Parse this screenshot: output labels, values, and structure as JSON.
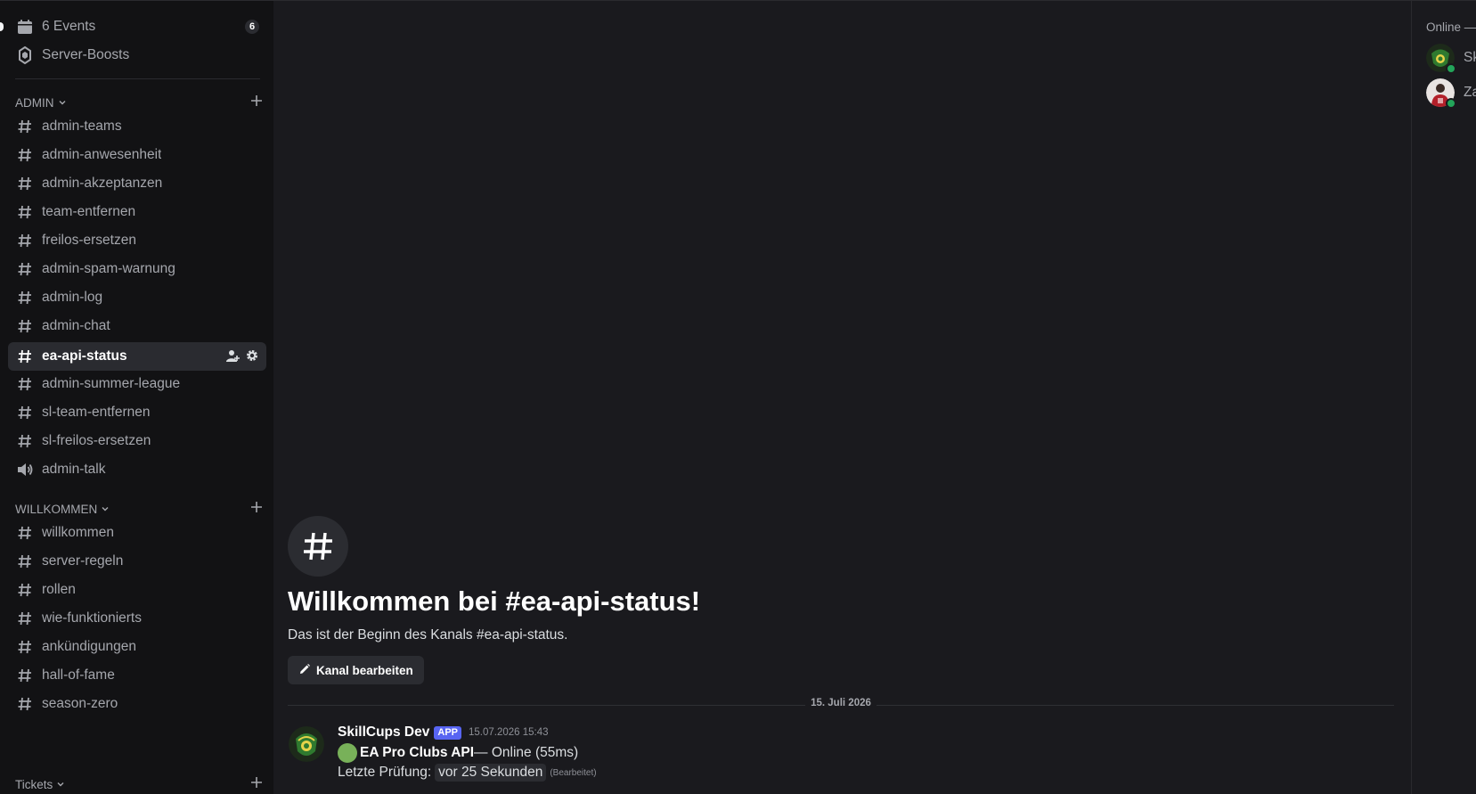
{
  "sidebar": {
    "top_items": [
      {
        "label": "6 Events",
        "icon": "calendar-icon",
        "badge": "6"
      },
      {
        "label": "Server-Boosts",
        "icon": "boost-icon"
      }
    ],
    "categories": [
      {
        "name": "ADMIN",
        "channels": [
          {
            "label": "admin-teams",
            "type": "text"
          },
          {
            "label": "admin-anwesenheit",
            "type": "text"
          },
          {
            "label": "admin-akzeptanzen",
            "type": "text"
          },
          {
            "label": "team-entfernen",
            "type": "text"
          },
          {
            "label": "freilos-ersetzen",
            "type": "text"
          },
          {
            "label": "admin-spam-warnung",
            "type": "text"
          },
          {
            "label": "admin-log",
            "type": "text"
          },
          {
            "label": "admin-chat",
            "type": "text"
          },
          {
            "label": "ea-api-status",
            "type": "text",
            "active": true
          },
          {
            "label": "admin-summer-league",
            "type": "text"
          },
          {
            "label": "sl-team-entfernen",
            "type": "text"
          },
          {
            "label": "sl-freilos-ersetzen",
            "type": "text"
          },
          {
            "label": "admin-talk",
            "type": "voice"
          }
        ]
      },
      {
        "name": "WILLKOMMEN",
        "channels": [
          {
            "label": "willkommen",
            "type": "text"
          },
          {
            "label": "server-regeln",
            "type": "text"
          },
          {
            "label": "rollen",
            "type": "text"
          },
          {
            "label": "wie-funktionierts",
            "type": "text"
          },
          {
            "label": "ankündigungen",
            "type": "text"
          },
          {
            "label": "hall-of-fame",
            "type": "text"
          },
          {
            "label": "season-zero",
            "type": "text"
          }
        ]
      },
      {
        "name": "Tickets",
        "channels": []
      }
    ]
  },
  "main": {
    "welcome_title": "Willkommen bei #ea-api-status!",
    "welcome_subtitle": "Das ist der Beginn des Kanals #ea-api-status.",
    "edit_button": "Kanal bearbeiten",
    "date_divider": "15. Juli 2026",
    "message": {
      "author": "SkillCups Dev",
      "tag": "APP",
      "timestamp": "15.07.2026 15:43",
      "service": "EA Pro Clubs API",
      "status": " — Online (55ms)",
      "check_label": "Letzte Prüfung:",
      "check_value": "vor 25 Sekunden",
      "edited": "(Bearbeitet)"
    }
  },
  "members": {
    "header": "Online —",
    "items": [
      {
        "name": "Sk",
        "status": "online"
      },
      {
        "name": "Za",
        "status": "online"
      }
    ]
  },
  "colors": {
    "accent": "#5865f2",
    "online": "#23a55a",
    "status_dot": "#78b159"
  }
}
